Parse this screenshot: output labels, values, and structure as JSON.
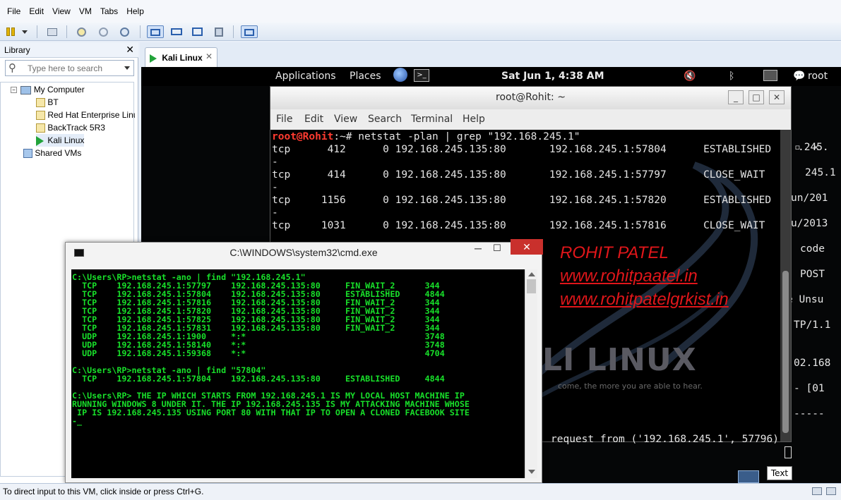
{
  "menu": [
    "File",
    "Edit",
    "View",
    "VM",
    "Tabs",
    "Help"
  ],
  "library": {
    "title": "Library",
    "search_placeholder": "Type here to search",
    "tree": [
      {
        "label": "My Computer"
      },
      {
        "label": "BT"
      },
      {
        "label": "Red Hat Enterprise Linu"
      },
      {
        "label": "BackTrack 5R3"
      },
      {
        "label": "Kali Linux"
      },
      {
        "label": "Shared VMs"
      }
    ]
  },
  "tab": {
    "label": "Kali Linux"
  },
  "gnome": {
    "applications": "Applications",
    "places": "Places",
    "clock": "Sat Jun  1,  4:38 AM",
    "user": "root"
  },
  "behind_lines": [
    ".245.",
    "245.1",
    "un/201",
    "u/2013",
    "code",
    "POST",
    "e Unsu",
    "TP/1.1",
    "02.168",
    "- [01",
    "-----"
  ],
  "terminal": {
    "title": "root@Rohit: ~",
    "menu": [
      "File",
      "Edit",
      "View",
      "Search",
      "Terminal",
      "Help"
    ],
    "prompt_user": "root@Rohit",
    "prompt_rest": ":~# netstat -plan | grep \"192.168.245.1\"",
    "lines": [
      "tcp      412      0 192.168.245.135:80       192.168.245.1:57804      ESTABLISHED",
      "-",
      "tcp      414      0 192.168.245.135:80       192.168.245.1:57797      CLOSE_WAIT",
      "-",
      "tcp     1156      0 192.168.245.135:80       192.168.245.1:57820      ESTABLISHED",
      "-",
      "tcp     1031      0 192.168.245.135:80       192.168.245.1:57816      CLOSE_WAIT"
    ],
    "bottom_line": "request from ('192.168.245.1', 57796)"
  },
  "kali_watermark": "LI LINUX",
  "kali_tagline": "come, the more you are able to hear.",
  "cmd": {
    "title": "C:\\WINDOWS\\system32\\cmd.exe",
    "lines": [
      "C:\\Users\\RP>netstat -ano | find \"192.168.245.1\"",
      "  TCP    192.168.245.1:57797    192.168.245.135:80     FIN_WAIT_2      344",
      "  TCP    192.168.245.1:57804    192.168.245.135:80     ESTABLISHED     4844",
      "  TCP    192.168.245.1:57816    192.168.245.135:80     FIN_WAIT_2      344",
      "  TCP    192.168.245.1:57820    192.168.245.135:80     FIN_WAIT_2      344",
      "  TCP    192.168.245.1:57825    192.168.245.135:80     FIN_WAIT_2      344",
      "  TCP    192.168.245.1:57831    192.168.245.135:80     FIN_WAIT_2      344",
      "  UDP    192.168.245.1:1900     *:*                                    3748",
      "  UDP    192.168.245.1:58140    *:*                                    3748",
      "  UDP    192.168.245.1:59368    *:*                                    4704",
      "",
      "C:\\Users\\RP>netstat -ano | find \"57804\"",
      "  TCP    192.168.245.1:57804    192.168.245.135:80     ESTABLISHED     4844",
      "",
      "C:\\Users\\RP> THE IP WHICH STARTS FROM 192.168.245.1 IS MY LOCAL HOST MACHINE IP",
      "RUNNING WINDOWS 8 UNDER IT. THE IP 192.168.245.135 IS MY ATTACKING MACHINE WHOSE",
      " IP IS 192.168.245.135 USING PORT 80 WITH THAT IP TO OPEN A CLONED FACEBOOK SITE",
      "-_"
    ]
  },
  "overlay": {
    "name": "ROHIT PATEL",
    "site1": "www.rohitpaatel.in",
    "site2": "www.rohitpatelgrkist.in"
  },
  "tooltip": "Text",
  "status": "To direct input to this VM, click inside or press Ctrl+G."
}
